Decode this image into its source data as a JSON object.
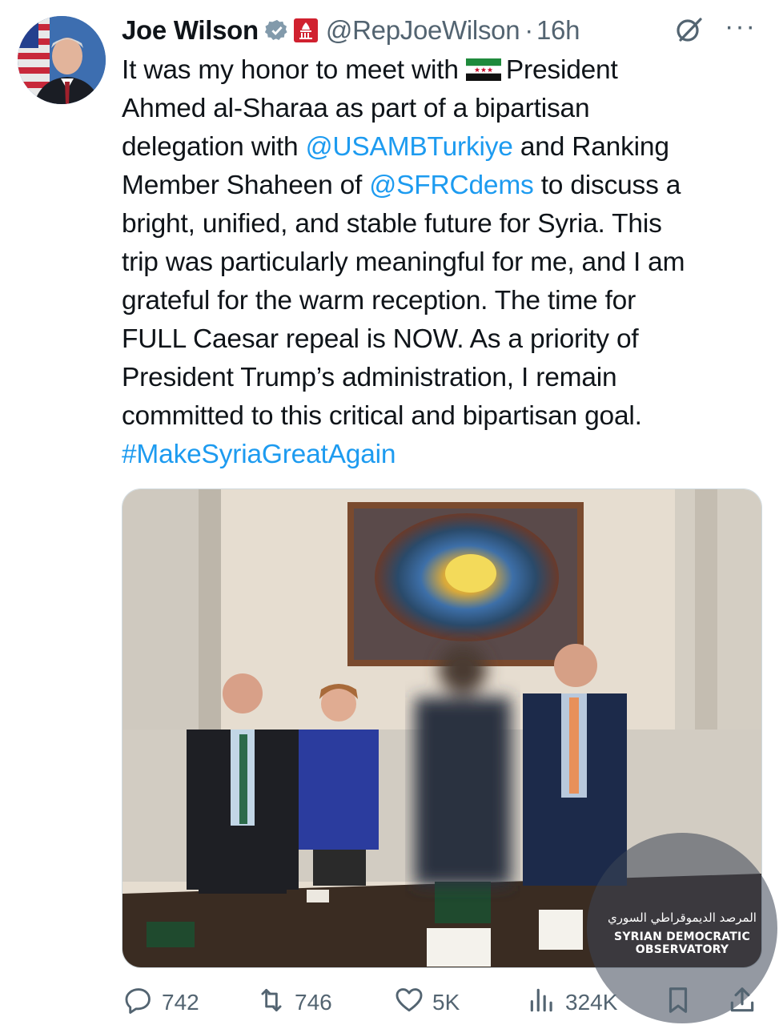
{
  "author": {
    "name": "Joe Wilson",
    "handle": "@RepJoeWilson",
    "separator": "·",
    "time": "16h"
  },
  "tweet": {
    "line1_text": "It was my honor to meet with ",
    "line1_after_flag": "President",
    "line2": "Ahmed al-Sharaa as part of a bipartisan",
    "line3_pre": "delegation with ",
    "mention1": "@USAMBTurkiye",
    "line3_post": " and Ranking",
    "line4_pre": "Member Shaheen of ",
    "mention2": "@SFRCdems",
    "line4_post": " to discuss a",
    "line5": "bright, unified, and stable future for Syria. This",
    "line6": "trip was particularly meaningful for me, and I am",
    "line7": "grateful for the warm reception. The time for",
    "line8": "FULL Caesar repeal is NOW. As a priority of",
    "line9": "President Trump’s administration, I remain",
    "line10": "committed to this critical and bipartisan goal.",
    "hashtag": "#MakeSyriaGreatAgain"
  },
  "metrics": {
    "replies": "742",
    "reposts": "746",
    "likes": "5K",
    "views": "324K"
  },
  "watermark": {
    "arabic": "المرصد الديموقراطي السوري",
    "english": "SYRIAN DEMOCRATIC OBSERVATORY"
  },
  "colors": {
    "link": "#1d9bf0",
    "muted": "#536471",
    "text": "#0f1419"
  },
  "icons": [
    "verified-icon",
    "gov-capitol-icon",
    "grok-icon",
    "more-icon",
    "syria-flag-icon",
    "reply-icon",
    "repost-icon",
    "like-icon",
    "views-icon",
    "bookmark-icon",
    "share-icon"
  ]
}
